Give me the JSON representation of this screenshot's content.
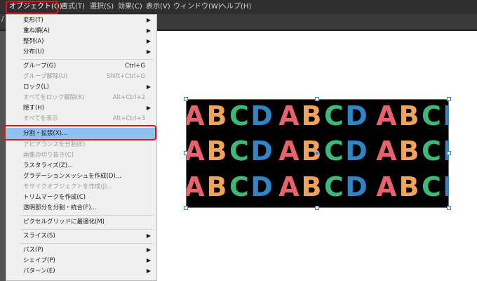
{
  "menubar": {
    "items": [
      {
        "label": "オブジェクト(O)",
        "active": true
      },
      {
        "label": "書式(T)"
      },
      {
        "label": "選択(S)"
      },
      {
        "label": "効果(C)"
      },
      {
        "label": "表示(V)"
      },
      {
        "label": "ウィンドウ(W)"
      },
      {
        "label": "ヘルプ(H)"
      }
    ]
  },
  "subbar": {
    "text": "/ ..."
  },
  "menu": {
    "items": [
      {
        "label": "変形(T)",
        "submenu": true
      },
      {
        "label": "重ね順(A)",
        "submenu": true
      },
      {
        "label": "整列(A)",
        "submenu": true
      },
      {
        "label": "分布(U)",
        "submenu": true
      },
      {
        "label": "グループ(G)",
        "shortcut": "Ctrl+G"
      },
      {
        "label": "グループ解除(U)",
        "shortcut": "Shift+Ctrl+G",
        "disabled": true
      },
      {
        "label": "ロック(L)",
        "submenu": true
      },
      {
        "label": "すべてをロック解除(K)",
        "shortcut": "Alt+Ctrl+2",
        "disabled": true
      },
      {
        "label": "隠す(H)",
        "submenu": true
      },
      {
        "label": "すべてを表示",
        "shortcut": "Alt+Ctrl+3",
        "disabled": true
      },
      {
        "label": "分割・拡張(X)...",
        "selected": true
      },
      {
        "label": "アピアランスを分割(E)",
        "disabled": true
      },
      {
        "label": "画像の切り抜き(C)",
        "disabled": true
      },
      {
        "label": "ラスタライズ(Z)..."
      },
      {
        "label": "グラデーションメッシュを作成(D)..."
      },
      {
        "label": "モザイクオブジェクトを作成(J)...",
        "disabled": true
      },
      {
        "label": "トリムマークを作成(C)"
      },
      {
        "label": "透明部分を分割・統合(F)..."
      },
      {
        "label": "ピクセルグリッドに最適化(M)"
      },
      {
        "label": "スライス(S)",
        "submenu": true
      },
      {
        "label": "パス(P)",
        "submenu": true
      },
      {
        "label": "シェイプ(P)",
        "submenu": true
      },
      {
        "label": "パターン(E)",
        "submenu": true
      }
    ]
  },
  "artwork": {
    "letters": [
      "A",
      "B",
      "C",
      "D"
    ],
    "colors": [
      "#e8626b",
      "#f0a35a",
      "#3cb878",
      "#2f86c6"
    ],
    "background": "#000000"
  },
  "colors": {
    "highlight": "#e0161b",
    "selection": "#3f7fd0",
    "menu_selected": "#8ec3ee"
  }
}
